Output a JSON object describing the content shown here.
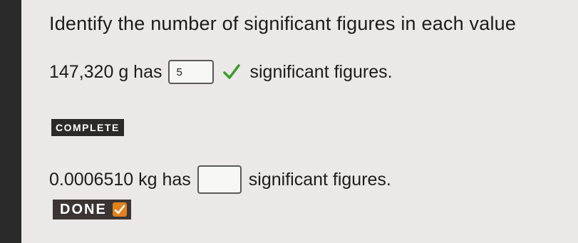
{
  "heading": "Identify the number of significant figures in each value",
  "questions": [
    {
      "value_text": "147,320 g has",
      "answer": "5",
      "suffix": "significant figures.",
      "status_badge": "COMPLETE"
    },
    {
      "value_text": "0.0006510 kg has",
      "answer": "",
      "suffix": "significant figures.",
      "status_badge": "DONE"
    }
  ],
  "colors": {
    "background": "#eae9e7",
    "check_green": "#3f9a2c",
    "badge_dark": "#2c2a28",
    "done_accent": "#e0811e"
  },
  "icons": [
    "checkmark-icon",
    "done-check-icon"
  ]
}
